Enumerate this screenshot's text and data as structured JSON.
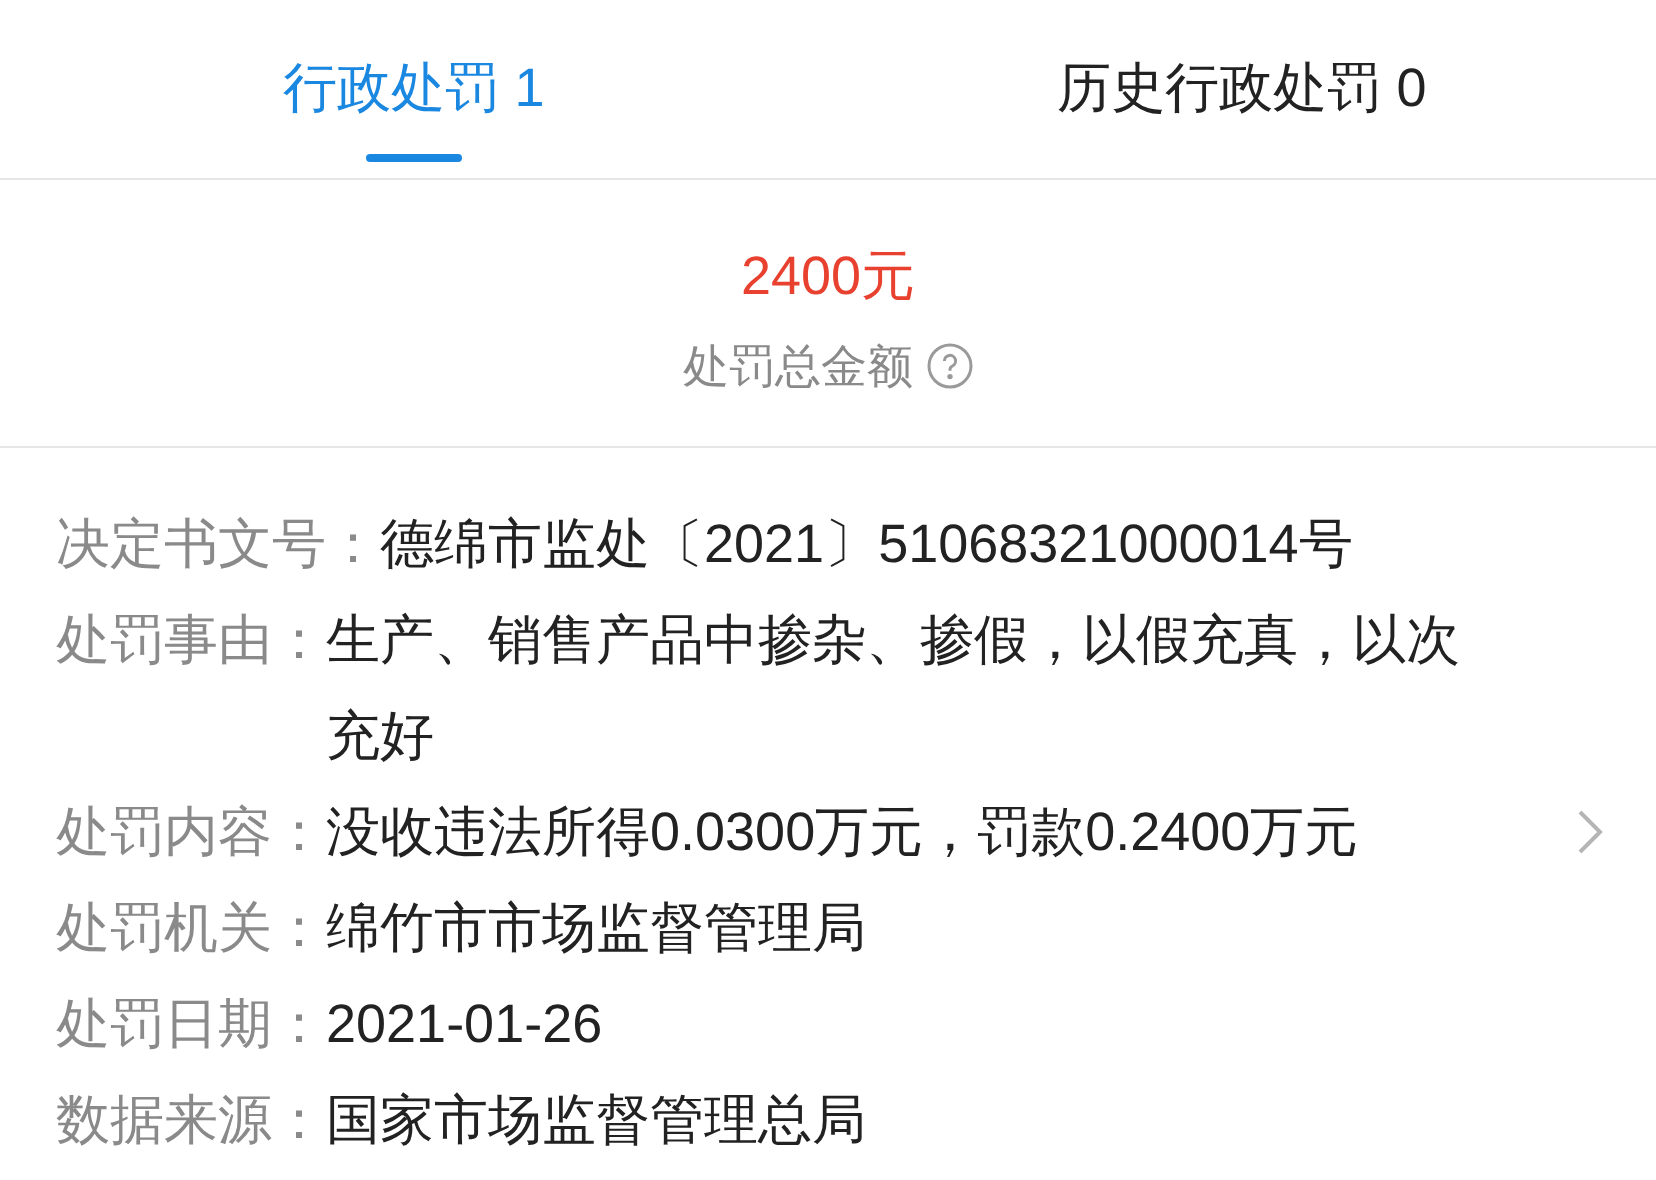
{
  "tabs": [
    {
      "label": "行政处罚 1",
      "selected": true
    },
    {
      "label": "历史行政处罚 0",
      "selected": false
    }
  ],
  "summary": {
    "amount": "2400元",
    "caption": "处罚总金额"
  },
  "details": [
    {
      "label": "决定书文号：",
      "value": "德绵市监处〔2021〕51068321000014号",
      "more": false
    },
    {
      "label": "处罚事由：",
      "value": "生产、销售产品中掺杂、掺假，以假充真，以次充好",
      "more": false
    },
    {
      "label": "处罚内容：",
      "value": "没收违法所得0.0300万元，罚款0.2400万元",
      "more": true
    },
    {
      "label": "处罚机关：",
      "value": "绵竹市市场监督管理局",
      "more": false
    },
    {
      "label": "处罚日期：",
      "value": "2021-01-26",
      "more": false
    },
    {
      "label": "数据来源：",
      "value": "国家市场监督管理总局",
      "more": false
    }
  ]
}
